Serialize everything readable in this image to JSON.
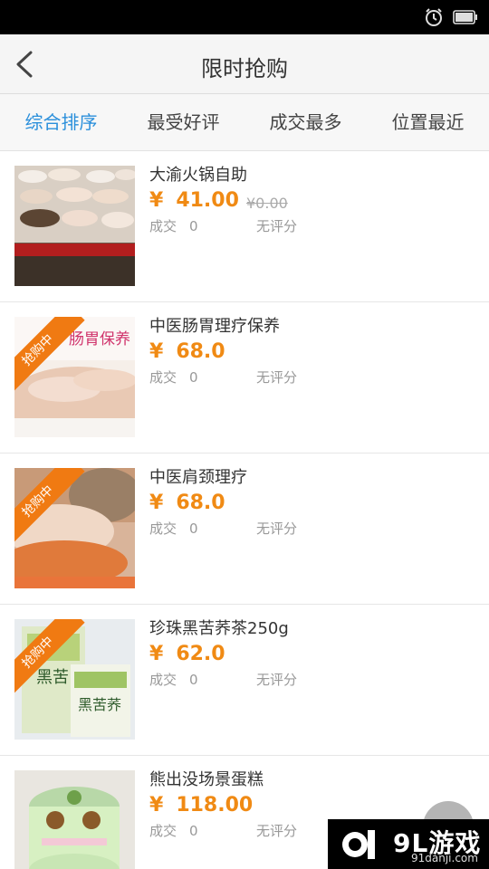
{
  "header": {
    "title": "限时抢购"
  },
  "tabs": [
    {
      "label": "综合排序",
      "active": true
    },
    {
      "label": "最受好评"
    },
    {
      "label": "成交最多"
    },
    {
      "label": "位置最近"
    }
  ],
  "items": [
    {
      "name": "大渝火锅自助",
      "currency": "¥",
      "price": "41.00",
      "original_price": "¥0.00",
      "sold_label": "成交",
      "sold": "0",
      "rating": "无评分",
      "badge": ""
    },
    {
      "name": "中医肠胃理疗保养",
      "currency": "¥",
      "price": "68.0",
      "sold_label": "成交",
      "sold": "0",
      "rating": "无评分",
      "badge": "抢购中"
    },
    {
      "name": "中医肩颈理疗",
      "currency": "¥",
      "price": "68.0",
      "sold_label": "成交",
      "sold": "0",
      "rating": "无评分",
      "badge": "抢购中"
    },
    {
      "name": "珍珠黑苦荞茶250g",
      "currency": "¥",
      "price": "62.0",
      "sold_label": "成交",
      "sold": "0",
      "rating": "无评分",
      "badge": "抢购中"
    },
    {
      "name": "熊出没场景蛋糕",
      "currency": "¥",
      "price": "118.00",
      "sold_label": "成交",
      "sold": "0",
      "rating": "无评分",
      "badge": ""
    }
  ],
  "watermark": {
    "brand": "9L游戏",
    "url": "91danji.com"
  },
  "colors": {
    "accent": "#2a8fdb",
    "price": "#f08a14",
    "badge": "#f07a12"
  }
}
